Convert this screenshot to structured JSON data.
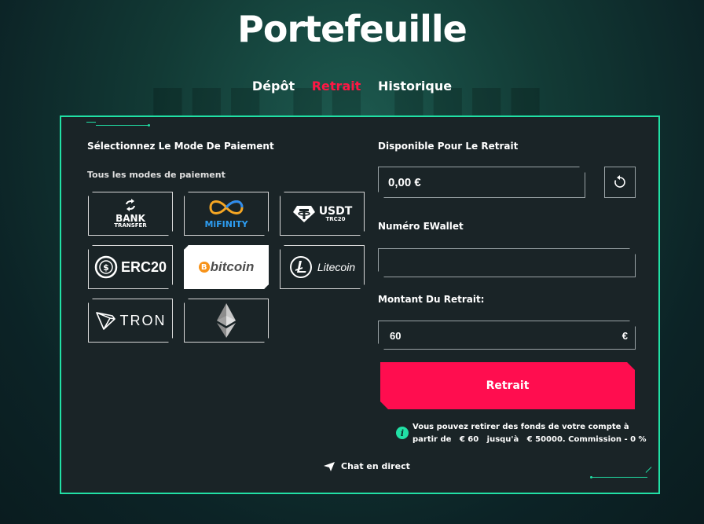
{
  "header": {
    "title": "Portefeuille",
    "tabs": [
      {
        "label": "Dépôt",
        "active": false
      },
      {
        "label": "Retrait",
        "active": true
      },
      {
        "label": "Historique",
        "active": false
      }
    ]
  },
  "left": {
    "section_title": "Sélectionnez Le Mode De Paiement",
    "filter_label": "Tous les modes de paiement",
    "methods": [
      {
        "name": "bank-transfer",
        "line1": "BANK",
        "line2": "TRANSFER"
      },
      {
        "name": "mifinity",
        "label": "MiFINITY"
      },
      {
        "name": "usdt",
        "label": "USDT",
        "sub": "TRC20"
      },
      {
        "name": "erc20",
        "label": "ERC20"
      },
      {
        "name": "bitcoin",
        "label": "bitcoin",
        "selected": true
      },
      {
        "name": "litecoin",
        "label": "Litecoin"
      },
      {
        "name": "tron",
        "label": "TRON"
      },
      {
        "name": "ethereum",
        "label": ""
      }
    ]
  },
  "right": {
    "available_label": "Disponible Pour Le Retrait",
    "available_value": "0,00 €",
    "ewallet_label": "Numéro EWallet",
    "ewallet_value": "",
    "amount_label": "Montant Du Retrait:",
    "amount_value": "60",
    "currency_symbol": "€",
    "submit_label": "Retrait",
    "info_line1": "Vous pouvez retirer des fonds de votre compte à",
    "info_line2": "partir de   € 60   jusqu'à   € 50000. Commission - 0 %"
  },
  "footer": {
    "chat_label": "Chat en direct"
  },
  "colors": {
    "accent": "#21e0a5",
    "primary": "#ff0d4f",
    "panel": "#1a2427"
  }
}
